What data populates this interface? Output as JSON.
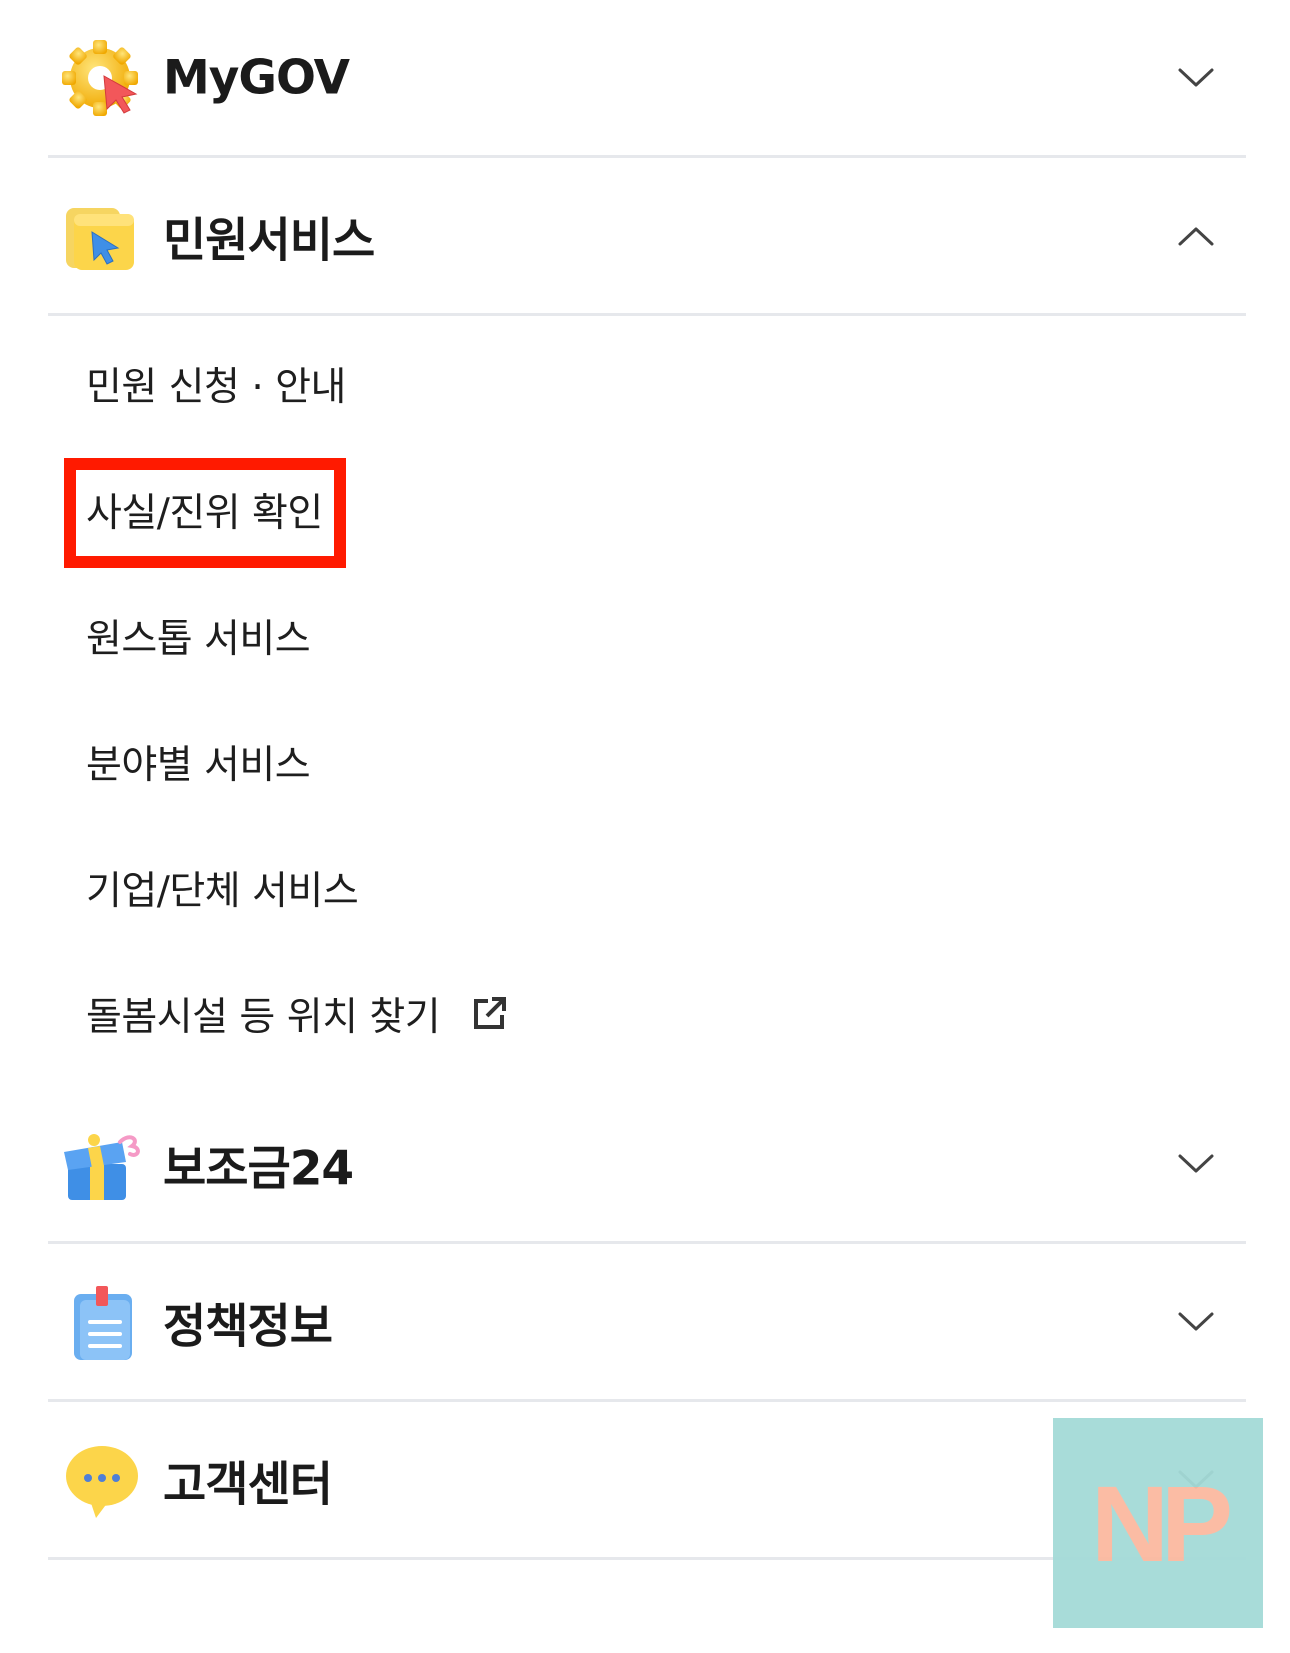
{
  "sections": [
    {
      "title": "MyGOV",
      "icon": "gear-cursor-icon",
      "expanded": false
    },
    {
      "title": "민원서비스",
      "icon": "folder-cursor-icon",
      "expanded": true
    },
    {
      "title": "보조금24",
      "icon": "gift-box-icon",
      "expanded": false
    },
    {
      "title": "정책정보",
      "icon": "clipboard-icon",
      "expanded": false
    },
    {
      "title": "고객센터",
      "icon": "speech-bubble-icon",
      "expanded": false
    }
  ],
  "civil_service_items": [
    {
      "label": "민원 신청 · 안내"
    },
    {
      "label": "사실/진위 확인",
      "highlighted": true
    },
    {
      "label": "원스톱 서비스"
    },
    {
      "label": "분야별 서비스"
    },
    {
      "label": "기업/단체 서비스"
    },
    {
      "label": "돌봄시설 등 위치 찾기",
      "external_link": true
    }
  ],
  "colors": {
    "highlight": "#ff1a00",
    "divider": "#e6e8ec",
    "watermark_bg": "#a4dbd8",
    "watermark_text": "#fbb9a0"
  },
  "watermark": {
    "text": "NP"
  }
}
